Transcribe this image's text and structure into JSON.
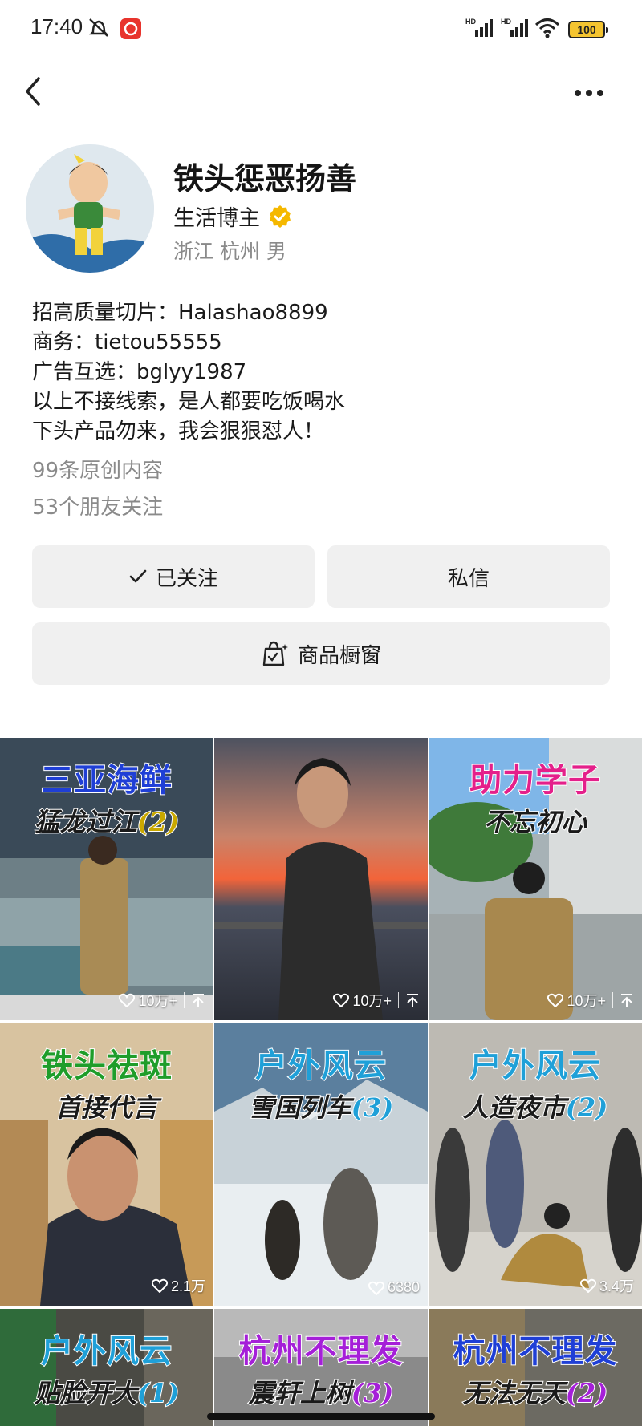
{
  "status_bar": {
    "time": "17:40",
    "battery": "100",
    "network_label": "HD",
    "icons": [
      "bell-muted-icon",
      "app-badge-icon",
      "signal-icon",
      "signal-icon",
      "wifi-icon",
      "battery-icon"
    ]
  },
  "nav": {
    "back_icon": "chevron-left-icon",
    "more_icon": "more-horizontal-icon"
  },
  "profile": {
    "name": "铁头惩恶扬善",
    "role": "生活博主",
    "location": "浙江 杭州 男",
    "bio": [
      "招高质量切片：Halashao8899",
      "商务：tietou55555",
      "广告互选：bglyy1987",
      "以上不接线索，是人都要吃饭喝水",
      "下头产品勿来，我会狠狠怼人！"
    ],
    "works_count": "99条原创内容",
    "friends_count": "53个朋友关注"
  },
  "actions": {
    "follow_label": "已关注",
    "message_label": "私信",
    "shop_label": "商品橱窗"
  },
  "videos": [
    {
      "title": "三亚海鲜",
      "subtitle": "猛龙过江",
      "episode": "(2)",
      "likes": "10万+",
      "title_color": "#1f3fd6",
      "pinned": true
    },
    {
      "title": "",
      "subtitle": "",
      "episode": "",
      "likes": "10万+",
      "title_color": "#000000",
      "pinned": true
    },
    {
      "title": "助力学子",
      "subtitle": "不忘初心",
      "episode": "",
      "likes": "10万+",
      "title_color": "#e4208a",
      "pinned": true
    },
    {
      "title": "铁头祛斑",
      "subtitle": "首接代言",
      "episode": "",
      "likes": "2.1万",
      "title_color": "#1f9d2a",
      "pinned": false
    },
    {
      "title": "户外风云",
      "subtitle": "雪国列车",
      "episode": "(3)",
      "likes": "6380",
      "title_color": "#1fa0d8",
      "pinned": false
    },
    {
      "title": "户外风云",
      "subtitle": "人造夜市",
      "episode": "(2)",
      "likes": "3.4万",
      "title_color": "#1fa0d8",
      "pinned": false
    },
    {
      "title": "户外风云",
      "subtitle": "贴脸开大",
      "episode": "(1)",
      "likes": "",
      "title_color": "#1fa0d8",
      "pinned": false
    },
    {
      "title": "杭州不理发",
      "subtitle": "震轩上树",
      "episode": "(3)",
      "likes": "",
      "title_color": "#a51fd8",
      "pinned": false
    },
    {
      "title": "杭州不理发",
      "subtitle": "无法无天",
      "episode": "(2)",
      "likes": "",
      "title_color": "#1f3fd6",
      "pinned": false
    }
  ]
}
